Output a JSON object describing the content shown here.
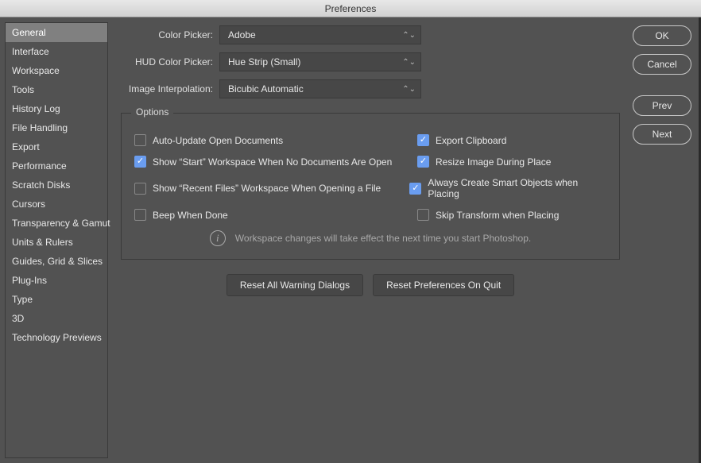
{
  "window": {
    "title": "Preferences"
  },
  "sidebar": {
    "items": [
      {
        "label": "General",
        "selected": true
      },
      {
        "label": "Interface"
      },
      {
        "label": "Workspace"
      },
      {
        "label": "Tools"
      },
      {
        "label": "History Log"
      },
      {
        "label": "File Handling"
      },
      {
        "label": "Export"
      },
      {
        "label": "Performance"
      },
      {
        "label": "Scratch Disks"
      },
      {
        "label": "Cursors"
      },
      {
        "label": "Transparency & Gamut"
      },
      {
        "label": "Units & Rulers"
      },
      {
        "label": "Guides, Grid & Slices"
      },
      {
        "label": "Plug-Ins"
      },
      {
        "label": "Type"
      },
      {
        "label": "3D"
      },
      {
        "label": "Technology Previews"
      }
    ]
  },
  "form": {
    "color_picker": {
      "label": "Color Picker:",
      "value": "Adobe"
    },
    "hud_color_picker": {
      "label": "HUD Color Picker:",
      "value": "Hue Strip (Small)"
    },
    "image_interpolation": {
      "label": "Image Interpolation:",
      "value": "Bicubic Automatic"
    }
  },
  "options": {
    "legend": "Options",
    "rows": [
      {
        "left": {
          "label": "Auto-Update Open Documents",
          "checked": false
        },
        "right": {
          "label": "Export Clipboard",
          "checked": true
        }
      },
      {
        "left": {
          "label": "Show “Start” Workspace When No Documents Are Open",
          "checked": true
        },
        "right": {
          "label": "Resize Image During Place",
          "checked": true
        }
      },
      {
        "left": {
          "label": "Show “Recent Files” Workspace When Opening a File",
          "checked": false
        },
        "right": {
          "label": "Always Create Smart Objects when Placing",
          "checked": true
        }
      },
      {
        "left": {
          "label": "Beep When Done",
          "checked": false
        },
        "right": {
          "label": "Skip Transform when Placing",
          "checked": false
        }
      }
    ],
    "info_text": "Workspace changes will take effect the next time you start Photoshop."
  },
  "actions": {
    "reset_warnings": "Reset All Warning Dialogs",
    "reset_on_quit": "Reset Preferences On Quit"
  },
  "buttons": {
    "ok": "OK",
    "cancel": "Cancel",
    "prev": "Prev",
    "next": "Next"
  }
}
